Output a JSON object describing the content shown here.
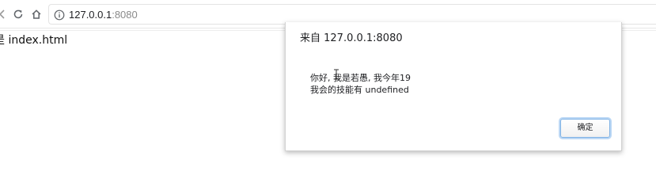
{
  "browser": {
    "address_host": "127.0.0.1",
    "address_port": ":8080",
    "icons": {
      "back": "back-arrow-icon",
      "reload": "reload-icon",
      "home": "home-icon",
      "info": "info-icon"
    }
  },
  "page": {
    "body_text": "是 index.html"
  },
  "dialog": {
    "title": "来自 127.0.0.1:8080",
    "message": "你好, 我是若愚, 我今年19\n我会的技能有 undefined",
    "ok_label": "确定"
  }
}
